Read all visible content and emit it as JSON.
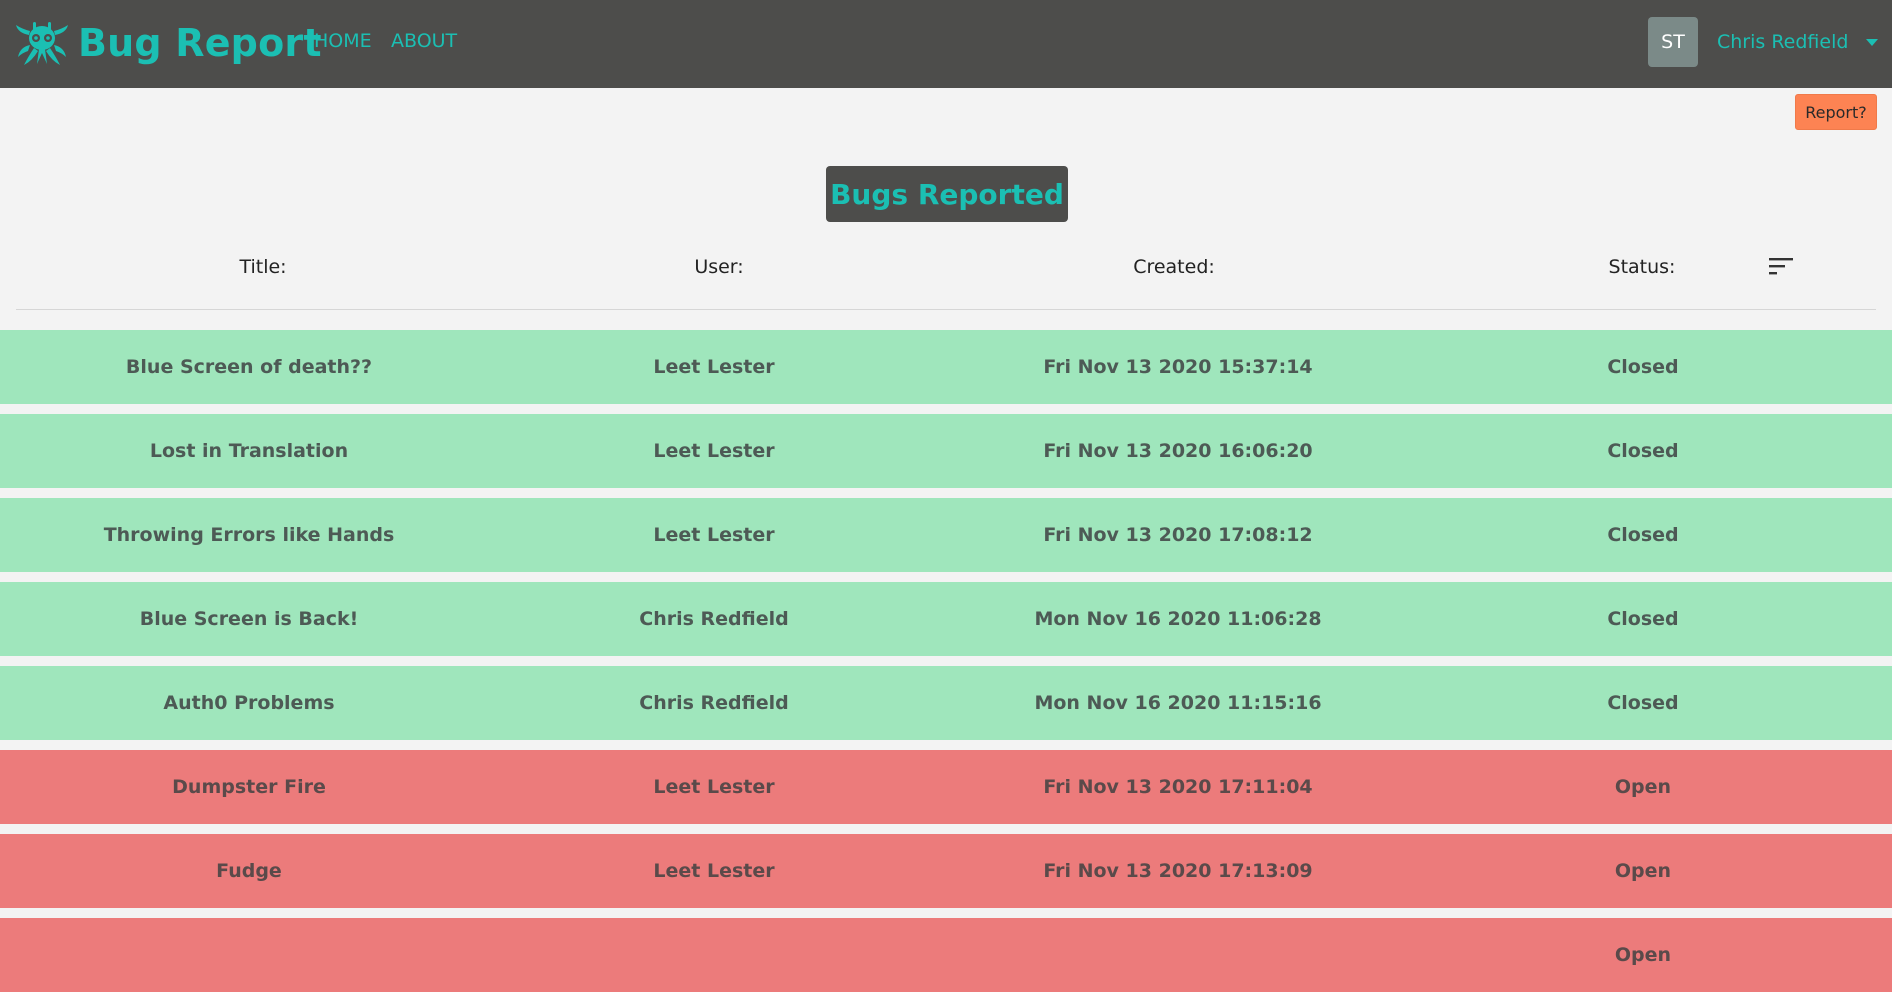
{
  "navbar": {
    "brand": "Bug Report",
    "brand_icon": "octopus-icon",
    "links": [
      "HOME",
      "ABOUT"
    ],
    "avatar_initials": "ST",
    "username": "Chris Redfield"
  },
  "report_button": "Report?",
  "page_title": "Bugs Reported",
  "table": {
    "headers": [
      "Title:",
      "User:",
      "Created:",
      "Status:"
    ],
    "sort_icon": "sort-icon",
    "rows": [
      {
        "title": "Blue Screen of death??",
        "user": "Leet Lester",
        "created": "Fri Nov 13 2020 15:37:14",
        "status": "Closed"
      },
      {
        "title": "Lost in Translation",
        "user": "Leet Lester",
        "created": "Fri Nov 13 2020 16:06:20",
        "status": "Closed"
      },
      {
        "title": "Throwing Errors like Hands",
        "user": "Leet Lester",
        "created": "Fri Nov 13 2020 17:08:12",
        "status": "Closed"
      },
      {
        "title": "Blue Screen is Back!",
        "user": "Chris Redfield",
        "created": "Mon Nov 16 2020 11:06:28",
        "status": "Closed"
      },
      {
        "title": "Auth0 Problems",
        "user": "Chris Redfield",
        "created": "Mon Nov 16 2020 11:15:16",
        "status": "Closed"
      },
      {
        "title": "Dumpster Fire",
        "user": "Leet Lester",
        "created": "Fri Nov 13 2020 17:11:04",
        "status": "Open"
      },
      {
        "title": "Fudge",
        "user": "Leet Lester",
        "created": "Fri Nov 13 2020 17:13:09",
        "status": "Open"
      },
      {
        "title": "",
        "user": "",
        "created": "",
        "status": "Open"
      }
    ]
  },
  "colors": {
    "navbar_bg": "#4d4d4b",
    "accent": "#1bbfb3",
    "closed_row": "#9fe6bc",
    "open_row": "#ec7b7b",
    "report_button": "#fd8353"
  }
}
